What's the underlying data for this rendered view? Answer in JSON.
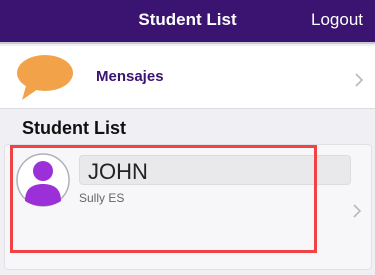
{
  "navbar": {
    "title": "Student List",
    "logout_label": "Logout"
  },
  "messages_row": {
    "label": "Mensajes",
    "icon": "speech-bubble-icon"
  },
  "section": {
    "header": "Student List"
  },
  "students": [
    {
      "name": "JOHN",
      "school": "Sully ES",
      "avatar_icon": "person-avatar-icon"
    }
  ],
  "colors": {
    "navbar_bg": "#3a1470",
    "accent_text": "#3a1470",
    "bubble": "#f2a34a",
    "avatar": "#9b30d9",
    "highlight": "#f04444"
  }
}
